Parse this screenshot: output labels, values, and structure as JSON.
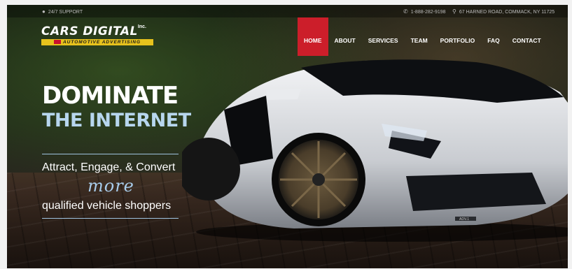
{
  "topbar": {
    "support": "24/7 SUPPORT",
    "phone": "1-888-282-9198",
    "address": "67 HARNED ROAD, COMMACK, NY 11725",
    "icons": [
      "user-icon",
      "phone-icon",
      "map-pin-icon"
    ]
  },
  "logo": {
    "main": "CARS DIGITAL",
    "inc": "Inc.",
    "sub": "AUTOMOTIVE ADVERTISING"
  },
  "nav": {
    "items": [
      {
        "label": "HOME",
        "active": true
      },
      {
        "label": "ABOUT"
      },
      {
        "label": "SERVICES"
      },
      {
        "label": "TEAM"
      },
      {
        "label": "PORTFOLIO"
      },
      {
        "label": "FAQ"
      },
      {
        "label": "CONTACT"
      }
    ]
  },
  "hero": {
    "line1": "DOMINATE",
    "line2": "THE INTERNET",
    "tagline1": "Attract, Engage, & Convert",
    "emphasis": "more",
    "tagline2": "qualified vehicle shoppers"
  },
  "car": {
    "plate": "ADV.1"
  },
  "colors": {
    "accent_red": "#cc1e2a",
    "logo_yellow": "#e7c21d",
    "hero_blue": "#b7d6ee"
  }
}
